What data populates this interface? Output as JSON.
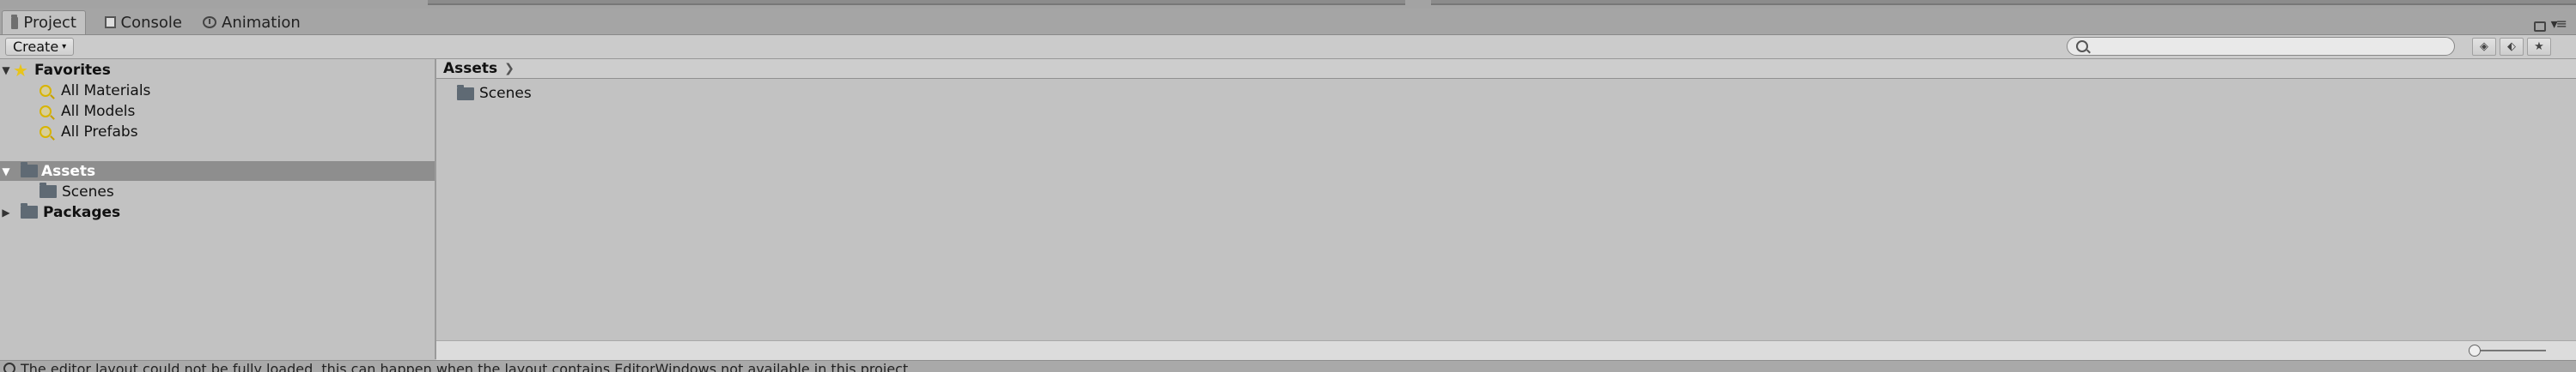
{
  "tabs": [
    {
      "label": "Project",
      "icon": "folder-icon",
      "active": true
    },
    {
      "label": "Console",
      "icon": "console-icon",
      "active": false
    },
    {
      "label": "Animation",
      "icon": "clock-icon",
      "active": false
    }
  ],
  "toolbar": {
    "create_label": "Create",
    "search_placeholder": "",
    "search_value": ""
  },
  "tree": {
    "favorites": {
      "label": "Favorites",
      "items": [
        "All Materials",
        "All Models",
        "All Prefabs"
      ]
    },
    "assets": {
      "label": "Assets",
      "children": [
        "Scenes"
      ]
    },
    "packages": {
      "label": "Packages"
    }
  },
  "content": {
    "breadcrumb": "Assets",
    "items": [
      "Scenes"
    ]
  },
  "slider": {
    "value": 0
  },
  "status": {
    "text": "The editor layout could not be fully loaded, this can happen when the layout contains EditorWindows not available in this project"
  },
  "colors": {
    "panel_bg": "#c2c2c2",
    "selected_row": "#8e8e8e",
    "star": "#e8c41a",
    "folder": "#5f6a74"
  }
}
